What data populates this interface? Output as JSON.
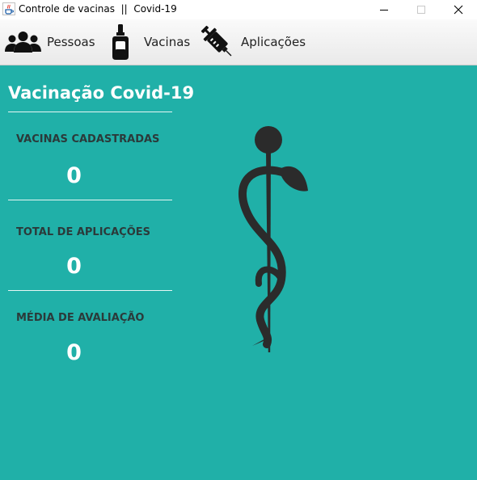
{
  "window": {
    "title": "Controle de vacinas  ||  Covid-19",
    "icon": "java-cup-icon",
    "controls": {
      "minimize": "minimize-icon",
      "maximize": "maximize-icon",
      "close": "close-icon"
    }
  },
  "menu": {
    "items": [
      {
        "label": "Pessoas",
        "icon": "people-icon"
      },
      {
        "label": "Vacinas",
        "icon": "vaccine-vial-icon"
      },
      {
        "label": "Aplicações",
        "icon": "syringe-icon"
      }
    ]
  },
  "main": {
    "title": "Vacinação Covid-19",
    "background_color": "#20b0a8",
    "stats": [
      {
        "label": "VACINAS CADASTRADAS",
        "value": "0"
      },
      {
        "label": "TOTAL DE APLICAÇÕES",
        "value": "0"
      },
      {
        "label": "MÉDIA DE AVALIAÇÃO",
        "value": "0"
      }
    ],
    "emblem": "rod-of-asclepius-icon"
  }
}
